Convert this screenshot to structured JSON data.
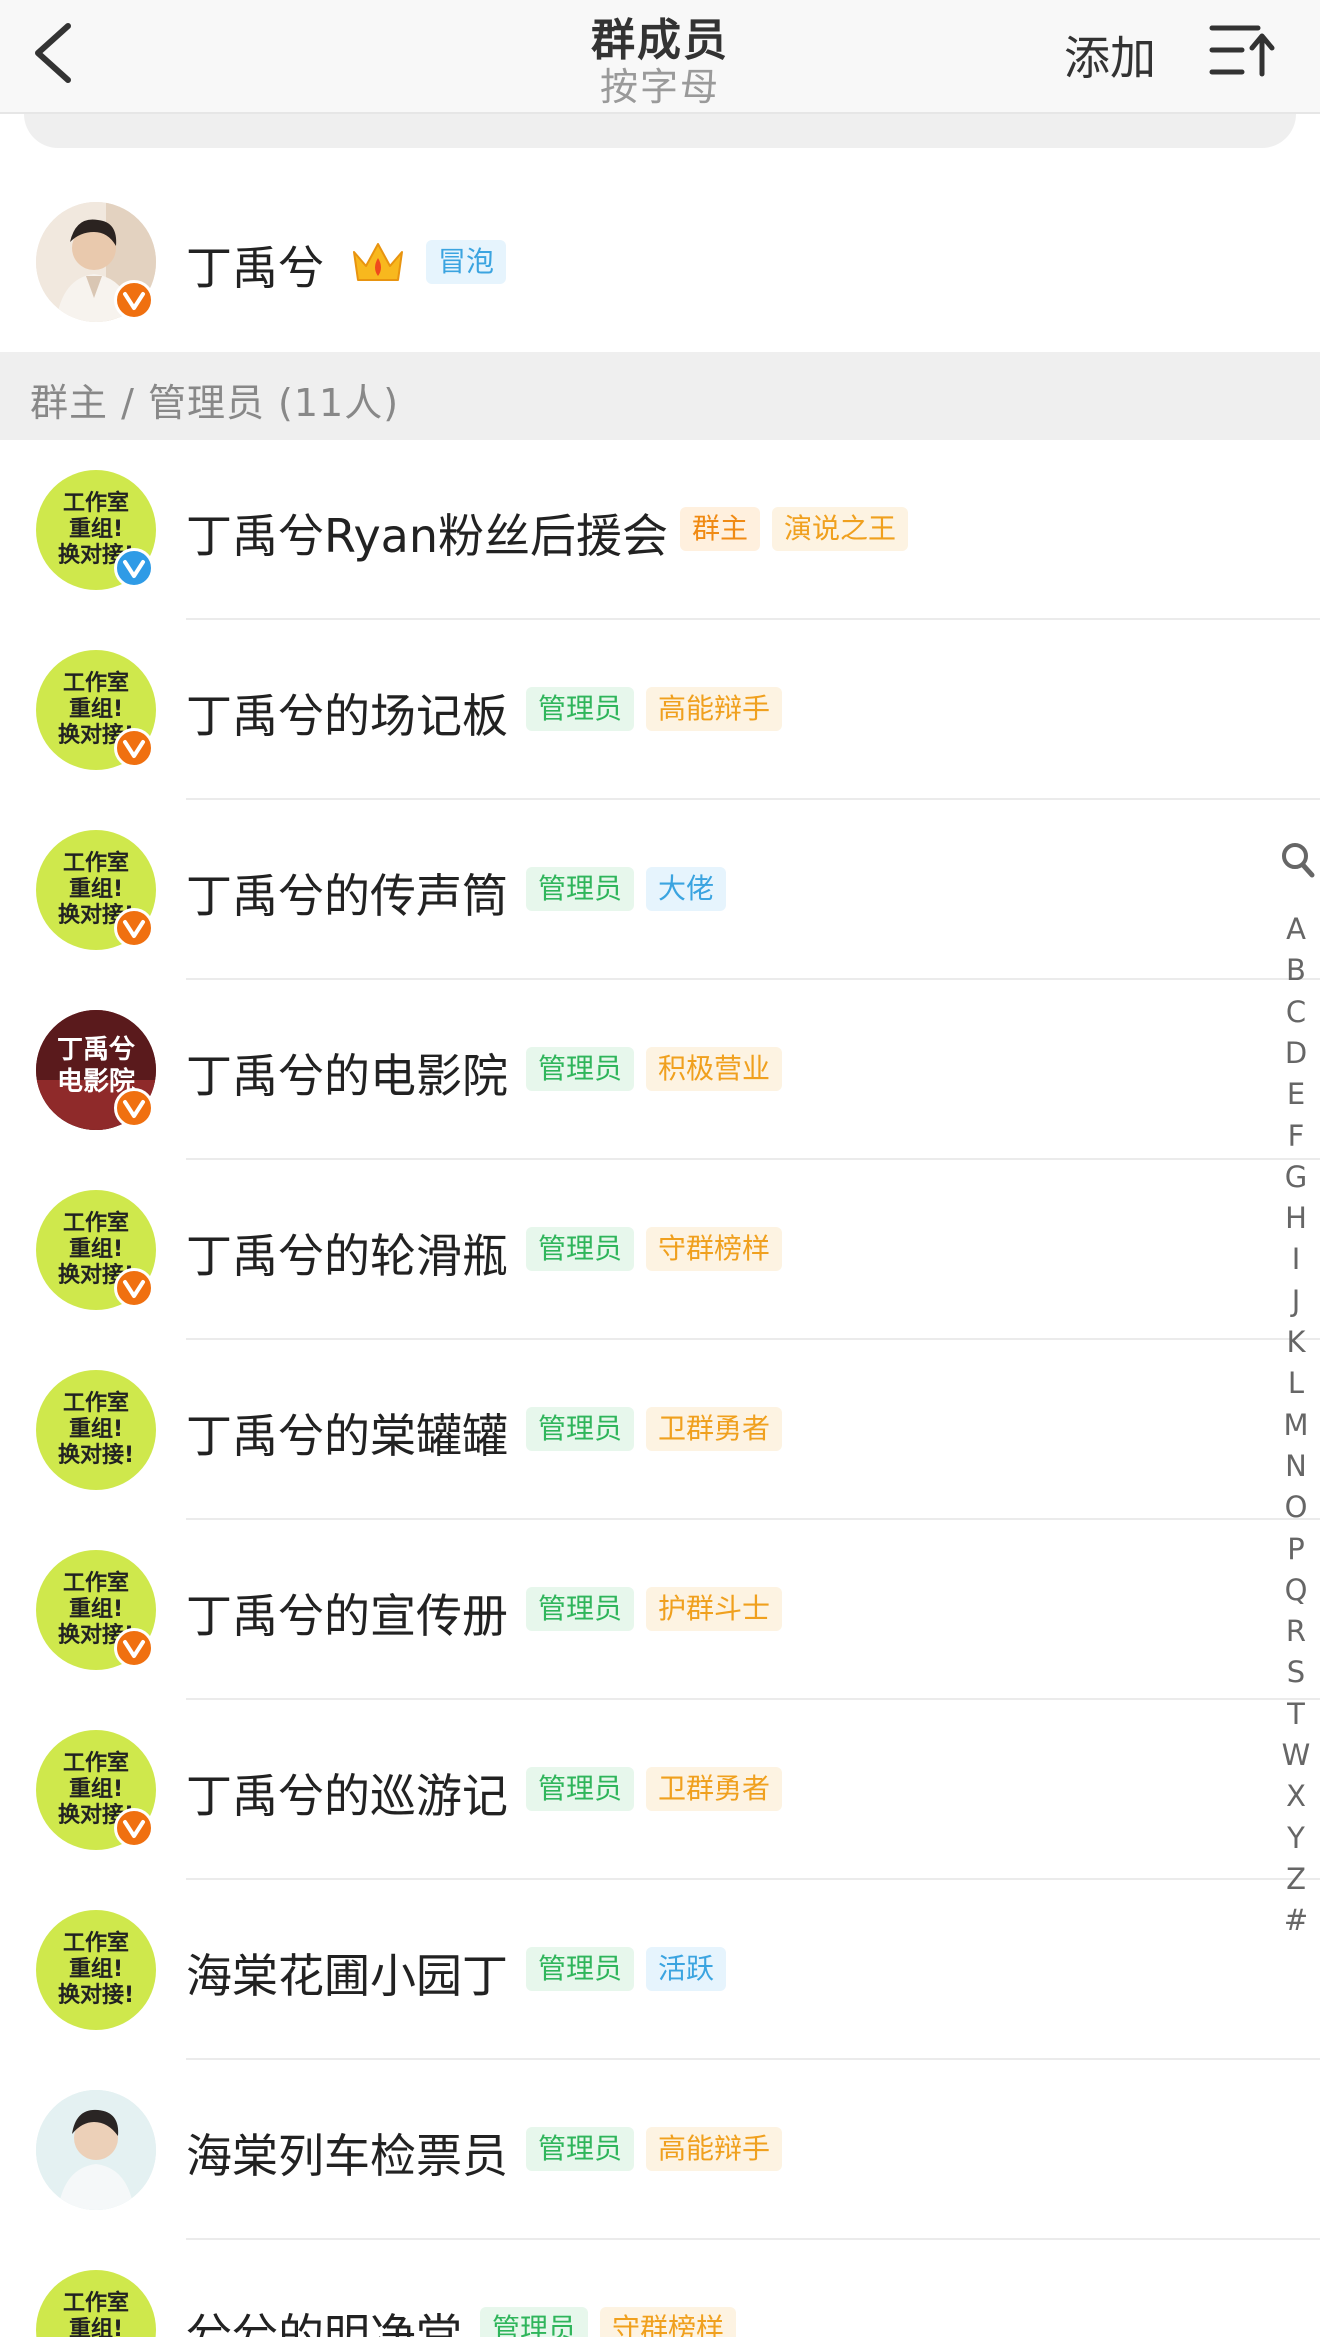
{
  "header": {
    "title": "群成员",
    "subtitle": "按字母",
    "add_label": "添加"
  },
  "owner": {
    "name": "丁禹兮",
    "tag": "冒泡"
  },
  "section": {
    "label": "群主 / 管理员 (11人)"
  },
  "members": [
    {
      "name": "丁禹兮Ryan粉丝后援会",
      "role": "群主",
      "title": "演说之王",
      "title_color": "orange",
      "badge": "blue"
    },
    {
      "name": "丁禹兮的场记板",
      "role": "管理员",
      "title": "高能辩手",
      "title_color": "orange",
      "badge": "orange"
    },
    {
      "name": "丁禹兮的传声筒",
      "role": "管理员",
      "title": "大佬",
      "title_color": "blue",
      "badge": "orange"
    },
    {
      "name": "丁禹兮的电影院",
      "role": "管理员",
      "title": "积极营业",
      "title_color": "orange",
      "badge": "orange"
    },
    {
      "name": "丁禹兮的轮滑瓶",
      "role": "管理员",
      "title": "守群榜样",
      "title_color": "orange",
      "badge": "orange"
    },
    {
      "name": "丁禹兮的棠罐罐",
      "role": "管理员",
      "title": "卫群勇者",
      "title_color": "orange",
      "badge": "none"
    },
    {
      "name": "丁禹兮的宣传册",
      "role": "管理员",
      "title": "护群斗士",
      "title_color": "orange",
      "badge": "orange"
    },
    {
      "name": "丁禹兮的巡游记",
      "role": "管理员",
      "title": "卫群勇者",
      "title_color": "orange",
      "badge": "orange"
    },
    {
      "name": "海棠花圃小园丁",
      "role": "管理员",
      "title": "活跃",
      "title_color": "blue",
      "badge": "none"
    },
    {
      "name": "海棠列车检票员",
      "role": "管理员",
      "title": "高能辩手",
      "title_color": "orange",
      "badge": "none"
    },
    {
      "name": "兮兮的明净堂",
      "role": "管理员",
      "title": "守群榜样",
      "title_color": "orange",
      "badge": "none"
    }
  ],
  "studio_avatar_text": [
    "工作室",
    "重组!",
    "换对接!"
  ],
  "cinema_avatar_text": [
    "丁禹兮",
    "电影院"
  ],
  "index_letters": [
    "A",
    "B",
    "C",
    "D",
    "E",
    "F",
    "G",
    "H",
    "I",
    "J",
    "K",
    "L",
    "M",
    "N",
    "O",
    "P",
    "Q",
    "R",
    "S",
    "T",
    "W",
    "X",
    "Y",
    "Z",
    "#"
  ],
  "colors": {
    "tag_green": "#2fb55b",
    "tag_orange": "#f0a01e",
    "tag_blue": "#3ba4e0",
    "badge_orange": "#f07010",
    "badge_blue": "#2f9be6",
    "avatar_green": "#cfe84c"
  },
  "icons": {
    "back": "back-arrow-icon",
    "sort": "sort-ascending-icon",
    "crown": "crown-icon",
    "search": "search-icon",
    "verified": "verified-v-icon"
  }
}
